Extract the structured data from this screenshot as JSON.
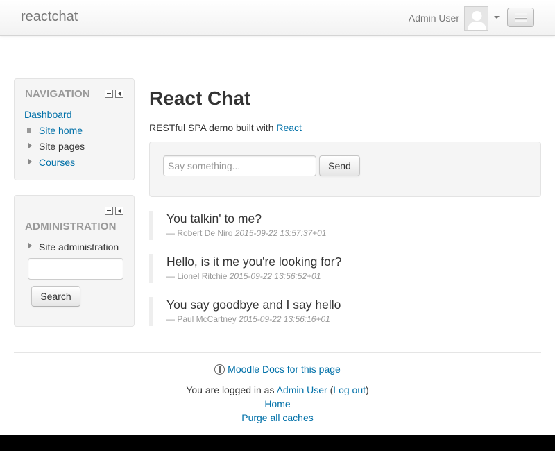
{
  "navbar": {
    "brand": "reactchat",
    "user_name": "Admin User"
  },
  "navigation_block": {
    "title": "NAVIGATION",
    "items": [
      {
        "label": "Dashboard",
        "type": "link"
      },
      {
        "label": "Site home",
        "type": "link",
        "marker": "square"
      },
      {
        "label": "Site pages",
        "type": "text",
        "marker": "expand-arrow"
      },
      {
        "label": "Courses",
        "type": "link",
        "marker": "expand-arrow"
      }
    ]
  },
  "administration_block": {
    "title": "ADMINISTRATION",
    "items": [
      {
        "label": "Site administration",
        "marker": "expand-arrow"
      }
    ],
    "search_value": "",
    "search_button": "Search"
  },
  "main": {
    "title": "React Chat",
    "intro_text": "RESTful SPA demo built with ",
    "intro_link": "React",
    "chat_placeholder": "Say something...",
    "send_button": "Send",
    "messages": [
      {
        "text": "You talkin' to me?",
        "author": "— Robert De Niro",
        "time": "2015-09-22 13:57:37+01"
      },
      {
        "text": "Hello, is it me you're looking for?",
        "author": "— Lionel Ritchie",
        "time": "2015-09-22 13:56:52+01"
      },
      {
        "text": "You say goodbye and I say hello",
        "author": "— Paul McCartney",
        "time": "2015-09-22 13:56:16+01"
      }
    ]
  },
  "footer": {
    "docs_link": "Moodle Docs for this page",
    "logged_in_prefix": "You are logged in as ",
    "logged_in_user": "Admin User",
    "open_paren": " (",
    "logout": "Log out",
    "close_paren": ")",
    "home": "Home",
    "purge": "Purge all caches"
  },
  "colors": {
    "link": "#0070a8",
    "text": "#333333",
    "muted": "#999999",
    "well_bg": "#f5f5f5"
  },
  "icons": [
    "user-avatar-icon",
    "caret-down-icon",
    "menu-toggle-icon",
    "block-minimize-icon",
    "block-dock-icon",
    "square-bullet-icon",
    "expand-arrow-icon",
    "info-icon"
  ]
}
